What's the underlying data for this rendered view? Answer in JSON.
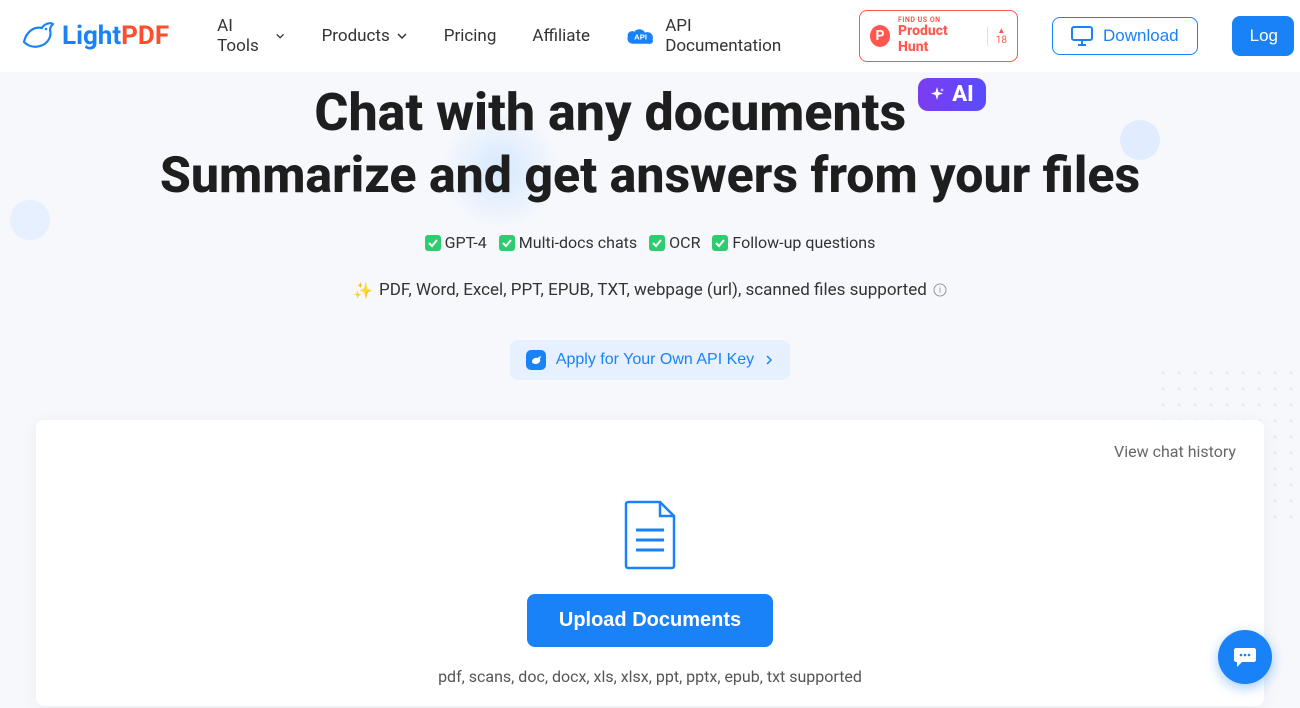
{
  "header": {
    "logo_light": "Light",
    "logo_pdf": "PDF",
    "nav": {
      "ai_tools": "AI Tools",
      "products": "Products",
      "pricing": "Pricing",
      "affiliate": "Affiliate",
      "api_docs": "API Documentation"
    },
    "product_hunt": {
      "find_us": "FIND US ON",
      "name": "Product Hunt",
      "count": "18"
    },
    "download": "Download",
    "login": "Log"
  },
  "hero": {
    "title": "Chat with any documents",
    "ai_badge": "AI",
    "subtitle": "Summarize and get answers from your files",
    "features": {
      "gpt4": "GPT-4",
      "multidocs": "Multi-docs chats",
      "ocr": "OCR",
      "followup": "Follow-up questions"
    },
    "supported": "PDF, Word, Excel, PPT, EPUB, TXT, webpage (url), scanned files supported",
    "api_key_button": "Apply for Your Own API Key"
  },
  "upload": {
    "view_history": "View chat history",
    "button": "Upload Documents",
    "formats": "pdf, scans, doc, docx, xls, xlsx, ppt, pptx, epub, txt supported"
  }
}
